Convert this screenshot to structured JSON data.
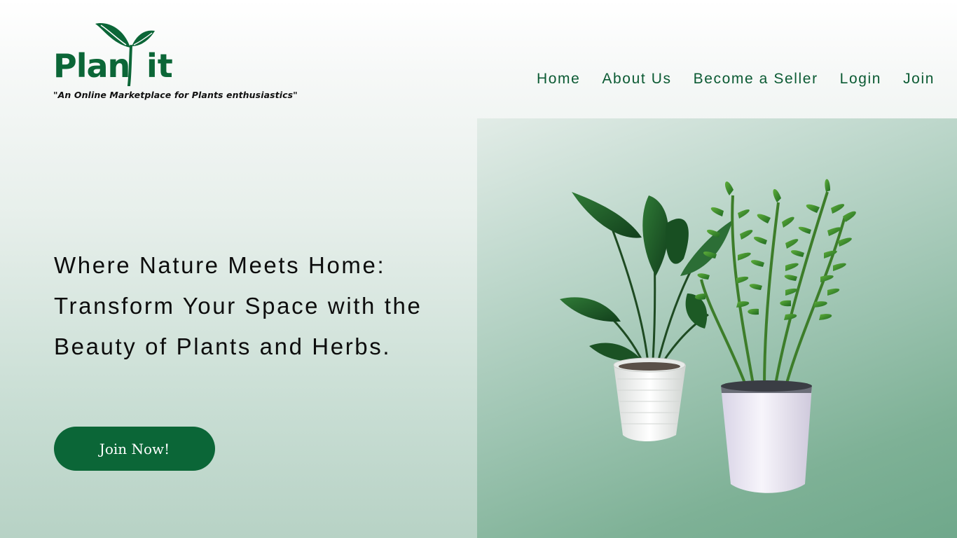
{
  "brand": {
    "name_left": "Plan",
    "name_right": "it",
    "tagline": "\"An Online Marketplace for Plants enthusiastics\"",
    "color": "#0b6637"
  },
  "nav": {
    "items": [
      {
        "label": "Home"
      },
      {
        "label": "About Us"
      },
      {
        "label": "Become a Seller"
      },
      {
        "label": "Login"
      },
      {
        "label": "Join"
      }
    ],
    "color": "#0b5a33"
  },
  "hero": {
    "headline": "Where Nature Meets Home: Transform Your Space with the Beauty of Plants and Herbs.",
    "cta_label": "Join Now!",
    "cta_color": "#0b6637",
    "image_icon": "potted-plants-illustration"
  }
}
